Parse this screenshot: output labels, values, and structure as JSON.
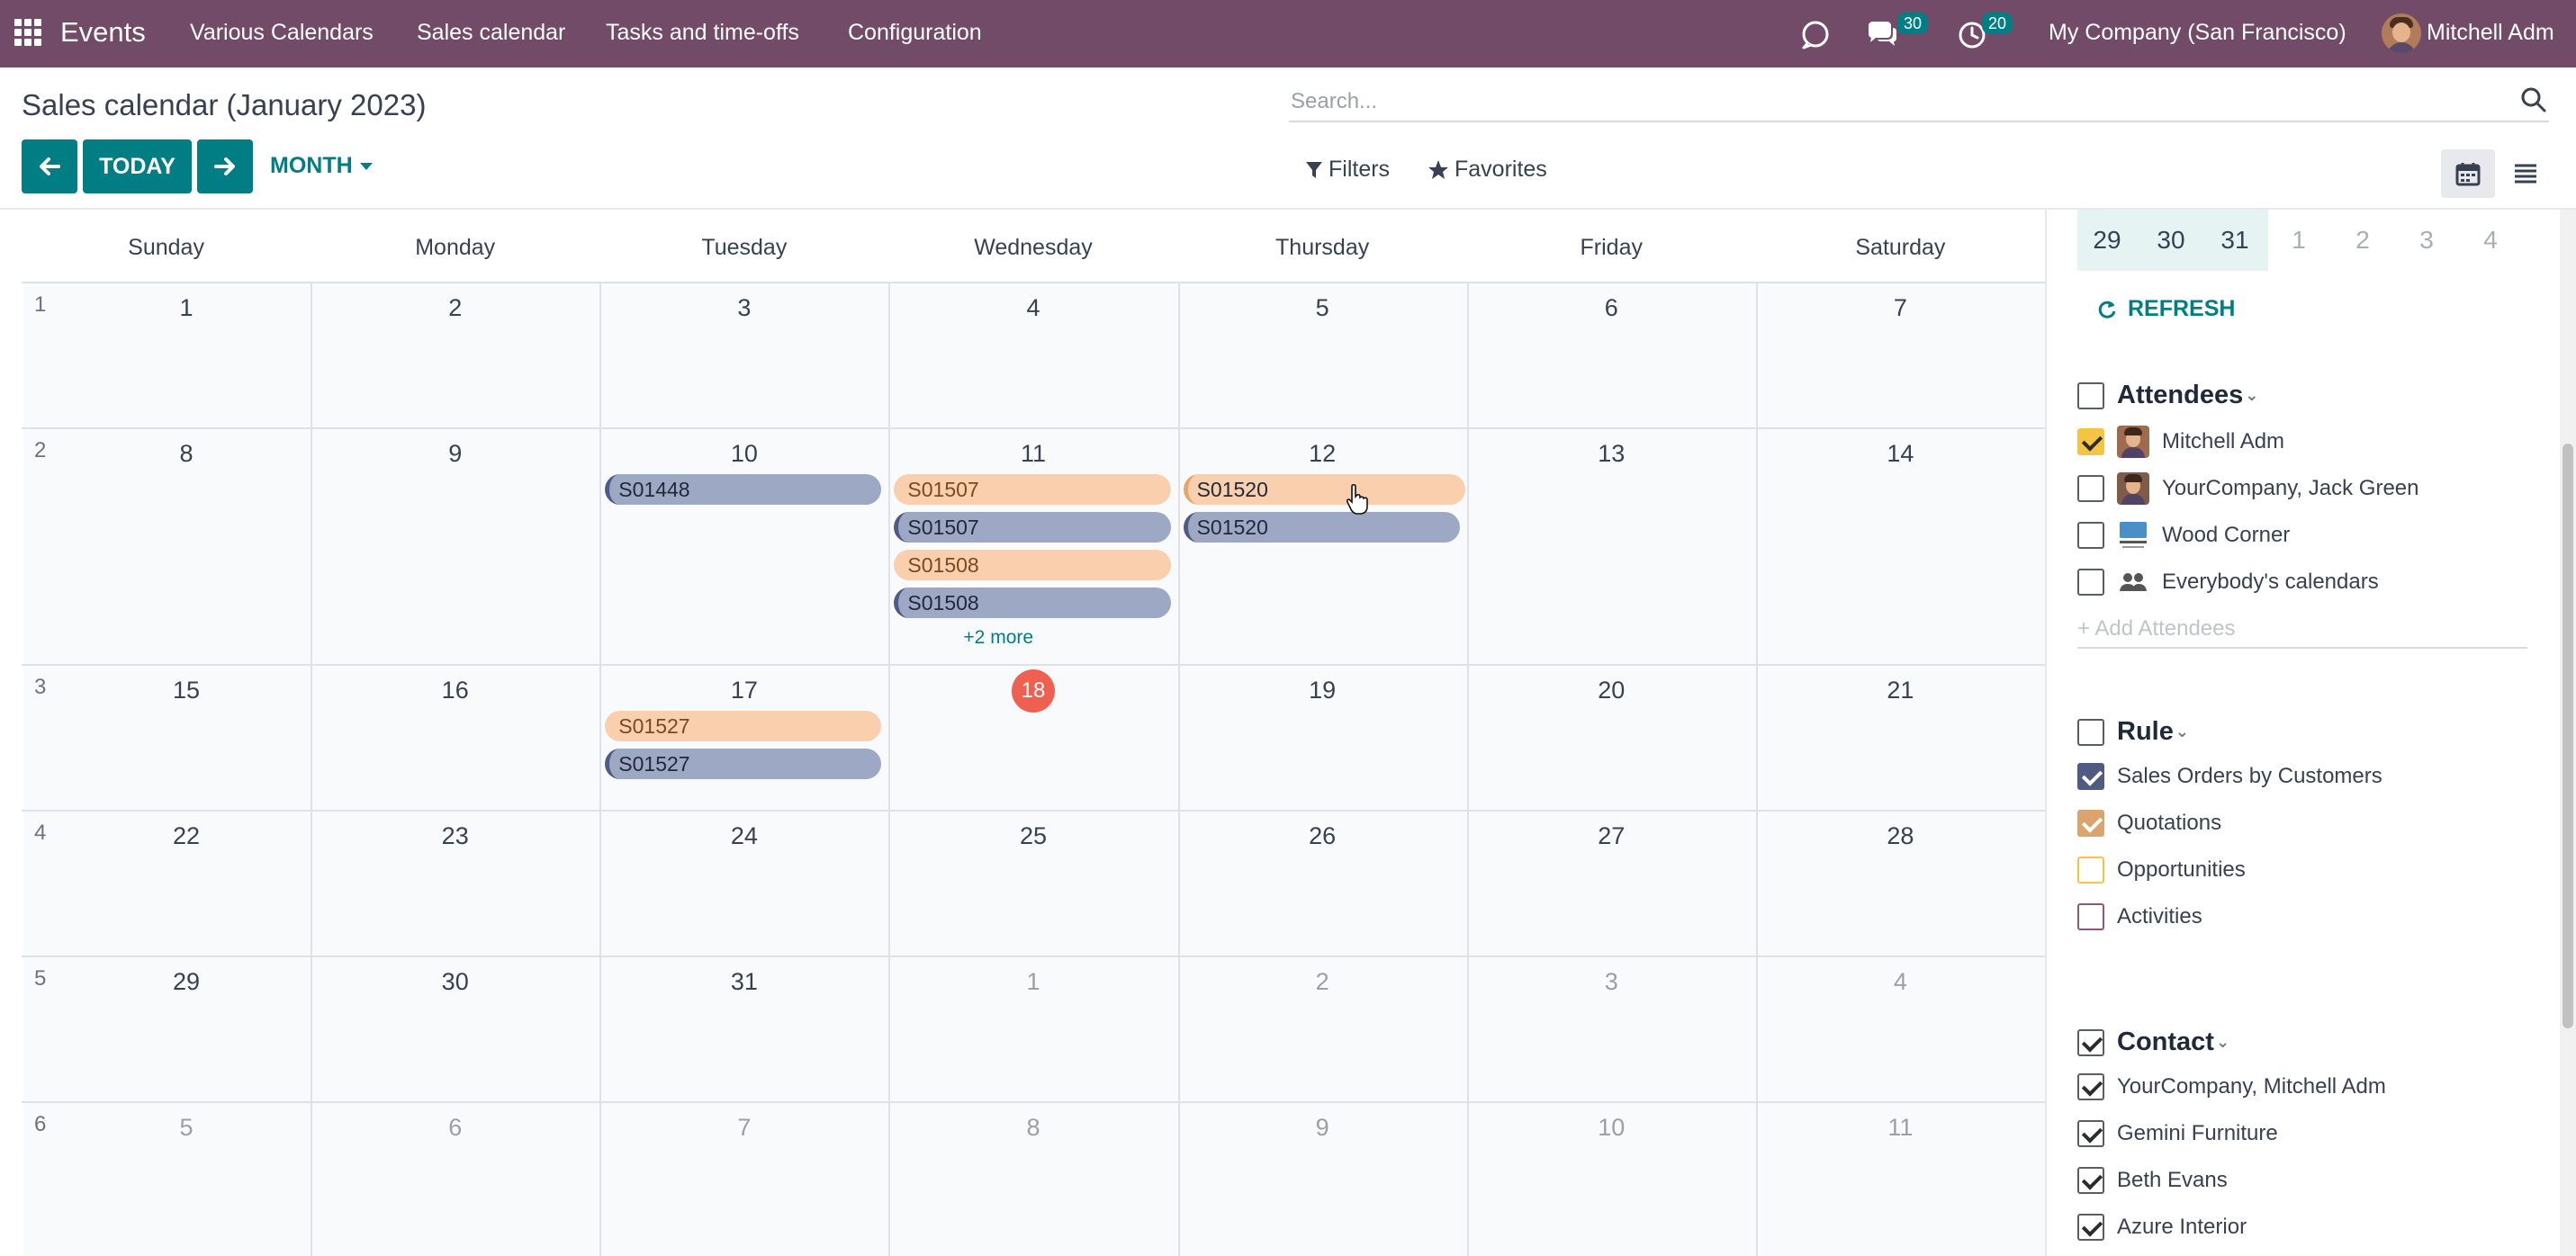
{
  "navbar": {
    "app_name": "Events",
    "menu": [
      "Various Calendars",
      "Sales calendar",
      "Tasks and time-offs",
      "Configuration"
    ],
    "messages_count": "30",
    "activities_count": "20",
    "company": "My Company (San Francisco)",
    "user": "Mitchell Adm",
    "bg_color": "#714B67"
  },
  "control": {
    "title": "Sales calendar (January 2023)",
    "search_placeholder": "Search...",
    "today_label": "TODAY",
    "scale_label": "MONTH",
    "filters_label": "Filters",
    "favorites_label": "Favorites",
    "accent_color": "#017E84"
  },
  "calendar": {
    "day_headers": [
      "Sunday",
      "Monday",
      "Tuesday",
      "Wednesday",
      "Thursday",
      "Friday",
      "Saturday"
    ],
    "weeks": [
      {
        "num": "1",
        "days": [
          "1",
          "2",
          "3",
          "4",
          "5",
          "6",
          "7"
        ],
        "other": [
          false,
          false,
          false,
          false,
          false,
          false,
          false
        ]
      },
      {
        "num": "2",
        "days": [
          "8",
          "9",
          "10",
          "11",
          "12",
          "13",
          "14"
        ],
        "other": [
          false,
          false,
          false,
          false,
          false,
          false,
          false
        ]
      },
      {
        "num": "3",
        "days": [
          "15",
          "16",
          "17",
          "18",
          "19",
          "20",
          "21"
        ],
        "other": [
          false,
          false,
          false,
          false,
          false,
          false,
          false
        ]
      },
      {
        "num": "4",
        "days": [
          "22",
          "23",
          "24",
          "25",
          "26",
          "27",
          "28"
        ],
        "other": [
          false,
          false,
          false,
          false,
          false,
          false,
          false
        ]
      },
      {
        "num": "5",
        "days": [
          "29",
          "30",
          "31",
          "1",
          "2",
          "3",
          "4"
        ],
        "other": [
          false,
          false,
          false,
          true,
          true,
          true,
          true
        ]
      },
      {
        "num": "6",
        "days": [
          "5",
          "6",
          "7",
          "8",
          "9",
          "10",
          "11"
        ],
        "other": [
          true,
          true,
          true,
          true,
          true,
          true,
          true
        ]
      }
    ],
    "today": "18",
    "events": [
      {
        "label": "S01448",
        "type": "so",
        "week": 1,
        "day": 2,
        "slot": 0
      },
      {
        "label": "S01507",
        "type": "quote",
        "week": 1,
        "day": 3,
        "slot": 0
      },
      {
        "label": "S01507",
        "type": "so",
        "week": 1,
        "day": 3,
        "slot": 1
      },
      {
        "label": "S01508",
        "type": "quote",
        "week": 1,
        "day": 3,
        "slot": 2
      },
      {
        "label": "S01508",
        "type": "so",
        "week": 1,
        "day": 3,
        "slot": 3
      },
      {
        "label": "S01520",
        "type": "quote-sel",
        "week": 1,
        "day": 4,
        "slot": 0
      },
      {
        "label": "S01520",
        "type": "so",
        "week": 1,
        "day": 4,
        "slot": 1
      },
      {
        "label": "S01527",
        "type": "quote",
        "week": 2,
        "day": 2,
        "slot": 0
      },
      {
        "label": "S01527",
        "type": "so",
        "week": 2,
        "day": 2,
        "slot": 1
      }
    ],
    "more_label": "+2 more",
    "quote_color": "#F9CFAE",
    "so_color": "#9CA8C4"
  },
  "sidebar": {
    "mini_days": [
      "29",
      "30",
      "31",
      "1",
      "2",
      "3",
      "4"
    ],
    "refresh_label": "REFRESH",
    "attendees": {
      "title": "Attendees",
      "items": [
        {
          "label": "Mitchell Adm",
          "checked": true,
          "color": "#F4C542"
        },
        {
          "label": "YourCompany, Jack Green",
          "checked": false,
          "color": ""
        },
        {
          "label": "Wood Corner",
          "checked": false,
          "color": ""
        },
        {
          "label": "Everybody's calendars",
          "checked": false,
          "color": ""
        }
      ],
      "add_placeholder": "+ Add Attendees"
    },
    "rule": {
      "title": "Rule",
      "items": [
        {
          "label": "Sales Orders by Customers",
          "checked": true,
          "color": "#4f5b82"
        },
        {
          "label": "Quotations",
          "checked": true,
          "color": "#D9A46E"
        },
        {
          "label": "Opportunities",
          "checked": false,
          "color": "#F4C542"
        },
        {
          "label": "Activities",
          "checked": false,
          "color": "#875A7B"
        }
      ]
    },
    "contact": {
      "title": "Contact",
      "items": [
        {
          "label": "YourCompany, Mitchell Adm",
          "checked": true
        },
        {
          "label": "Gemini Furniture",
          "checked": true
        },
        {
          "label": "Beth Evans",
          "checked": true
        },
        {
          "label": "Azure Interior",
          "checked": true
        }
      ]
    }
  }
}
